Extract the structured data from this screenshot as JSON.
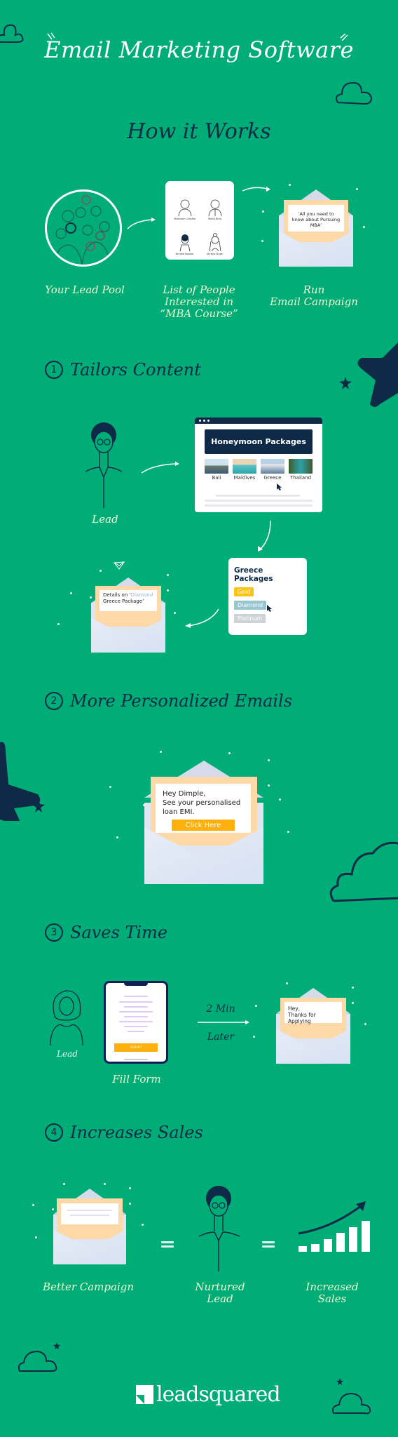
{
  "header": {
    "title": "Email Marketing Software",
    "subtitle": "How it Works"
  },
  "how_it_works": {
    "steps": [
      {
        "label": "Your Lead Pool"
      },
      {
        "label_lines": [
          "List of People",
          "Interested in",
          "“MBA Course”"
        ]
      },
      {
        "label_lines": [
          "Run",
          "Email Campaign"
        ]
      }
    ],
    "people": [
      "Shabnam Chadha",
      "Mohit Birla",
      "Dimple Kapoor",
      "Shreya Singh"
    ],
    "email_text": "‘All you need to know about Pursuing MBA’"
  },
  "sections": [
    {
      "number": "1",
      "title": "Tailors Content",
      "lead_label": "Lead",
      "webpage": {
        "banner": "Honeymoon Packages",
        "destinations": [
          "Bali",
          "Maldives",
          "Greece",
          "Thailand"
        ],
        "selected": "Greece"
      },
      "packages": {
        "title": "Greece Packages",
        "options": [
          {
            "label": "Gold",
            "color": "#fdc412"
          },
          {
            "label": "Diamond",
            "color": "#98c6d0"
          },
          {
            "label": "Platinum",
            "color": "#cfd3d6"
          }
        ],
        "selected": "Diamond"
      },
      "email": {
        "prefix": "Details on ‘",
        "highlight": "Diamond",
        "suffix": " Greece Package’"
      }
    },
    {
      "number": "2",
      "title": "More Personalized Emails",
      "email": {
        "line1": "Hey Dimple,",
        "line2": "See your personalised",
        "line3": "loan EMI.",
        "button": "Click Here"
      }
    },
    {
      "number": "3",
      "title": "Saves Time",
      "lead_label": "Lead",
      "form_label": "Fill Form",
      "submit_label": "SUBMIT",
      "delay_top": "2 Min",
      "delay_bottom": "Later",
      "email": {
        "line1": "Hey,",
        "line2": "Thanks for Applying"
      }
    },
    {
      "number": "4",
      "title": "Increases Sales",
      "items": [
        {
          "label": "Better Campaign"
        },
        {
          "label_lines": [
            "Nurtured",
            "Lead"
          ]
        },
        {
          "label_lines": [
            "Increased",
            "Sales"
          ]
        }
      ],
      "sales_bars": [
        1,
        1.4,
        2.2,
        3.3,
        4.3,
        5.4
      ]
    }
  ],
  "footer": {
    "brand": "leadsquared"
  },
  "colors": {
    "background": "#00ad77",
    "navy": "#0e2a47",
    "accent_orange": "#fdaf0b",
    "caption": "#f1f8d3"
  }
}
